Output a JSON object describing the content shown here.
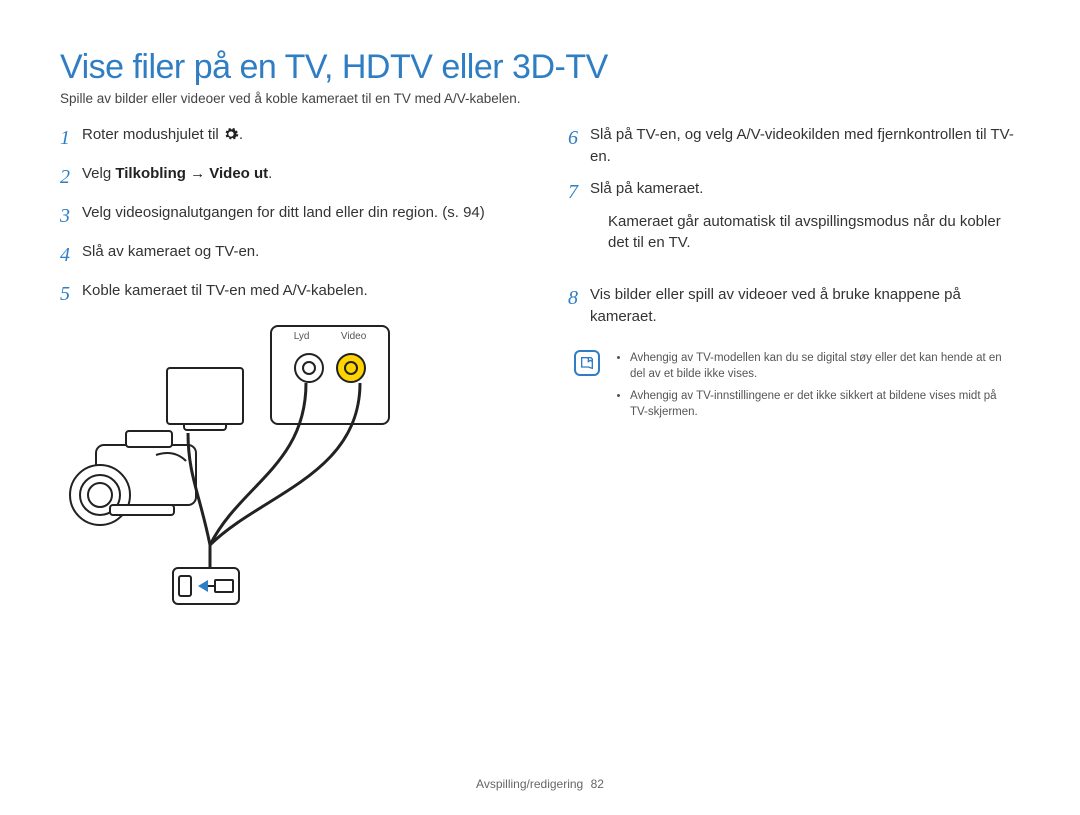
{
  "title": "Vise filer på en TV, HDTV eller 3D-TV",
  "subtitle": "Spille av bilder eller videoer ved å koble kameraet til en TV med A/V-kabelen.",
  "left_steps": [
    {
      "n": "1",
      "prefix": "Roter modushjulet til ",
      "icon": "gear",
      "suffix": "."
    },
    {
      "n": "2",
      "prefix": "Velg ",
      "bold": "Tilkobling → Video ut",
      "suffix": "."
    },
    {
      "n": "3",
      "text": "Velg videosignalutgangen for ditt land eller din region. (s. 94)"
    },
    {
      "n": "4",
      "text": "Slå av kameraet og TV-en."
    },
    {
      "n": "5",
      "text": "Koble kameraet til TV-en med A/V-kabelen."
    }
  ],
  "right_steps": [
    {
      "n": "6",
      "text": "Slå på TV-en, og velg A/V-videokilden med fjernkontrollen til TV-en."
    },
    {
      "n": "7",
      "text": "Slå på kameraet.",
      "sub": [
        "Kameraet går automatisk til avspillingsmodus når du kobler det til en TV."
      ]
    },
    {
      "n": "8",
      "text": "Vis bilder eller spill av videoer ved å bruke knappene på kameraet."
    }
  ],
  "notes": [
    "Avhengig av TV-modellen kan du se digital støy eller det kan hende at en del av et bilde ikke vises.",
    "Avhengig av TV-innstillingene er det ikke sikkert at bildene vises midt på TV-skjermen."
  ],
  "diagram_labels": {
    "audio": "Lyd",
    "video": "Video"
  },
  "footer": {
    "section": "Avspilling/redigering",
    "page": "82"
  }
}
